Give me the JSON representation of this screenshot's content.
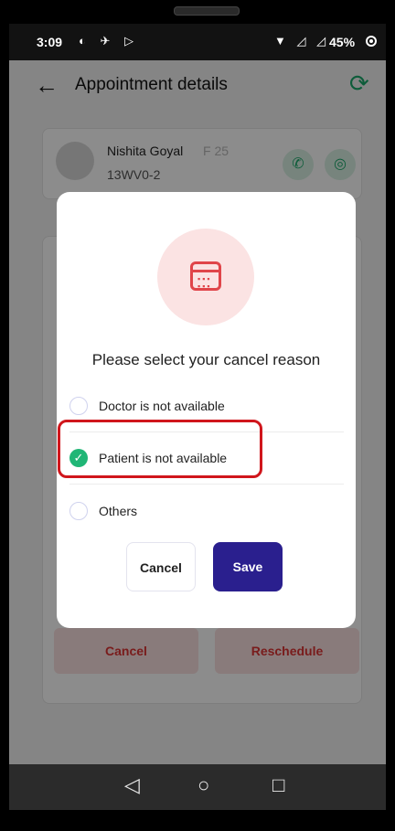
{
  "status_bar": {
    "time": "3:09",
    "battery": "45%"
  },
  "app_bar": {
    "title": "Appointment details",
    "back_icon": "arrow-left-icon",
    "refresh_icon": "refresh-icon"
  },
  "patient": {
    "name": "Nishita Goyal",
    "meta": "F 25",
    "code": "13WV0-2"
  },
  "background_actions": {
    "cancel_label": "Cancel",
    "reschedule_label": "Reschedule"
  },
  "dialog": {
    "heading": "Please select your cancel reason",
    "options": [
      {
        "label": "Doctor is not available",
        "selected": false
      },
      {
        "label": "Patient is not available",
        "selected": true
      },
      {
        "label": "Others",
        "selected": false
      }
    ],
    "cancel_label": "Cancel",
    "save_label": "Save"
  },
  "colors": {
    "accent": "#2a1f8e",
    "success": "#20b676",
    "danger": "#e0454a",
    "highlight": "#d0161c"
  }
}
